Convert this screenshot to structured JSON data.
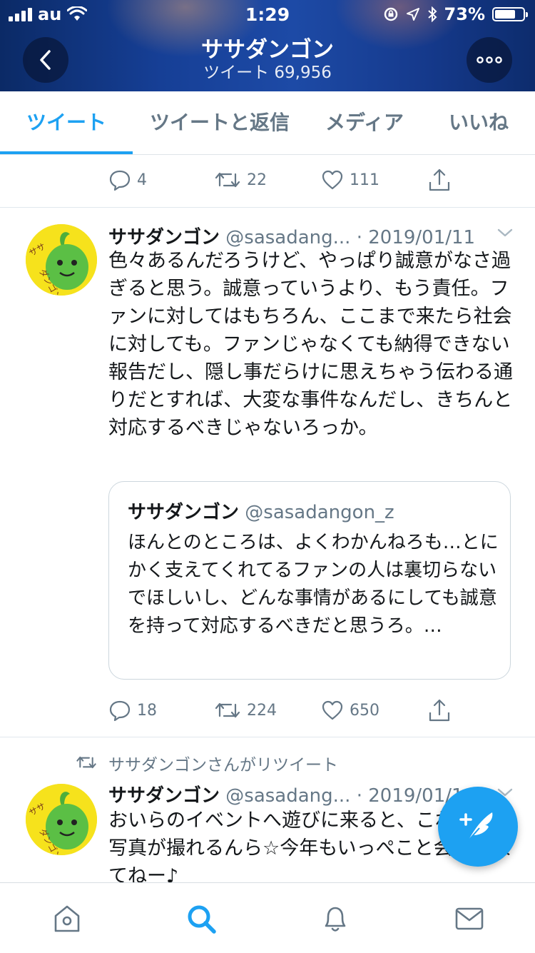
{
  "status_bar": {
    "carrier": "au",
    "time": "1:29",
    "battery": "73%",
    "battery_level": 0.73
  },
  "header": {
    "title": "ササダンゴン",
    "subtitle": "ツイート 69,956"
  },
  "tabs": [
    {
      "label": "ツイート",
      "active": true
    },
    {
      "label": "ツイートと返信",
      "active": false
    },
    {
      "label": "メディア",
      "active": false
    },
    {
      "label": "いいね",
      "active": false
    }
  ],
  "prev_tweet": {
    "replies": "4",
    "retweets": "22",
    "likes": "111"
  },
  "tweet1": {
    "name": "ササダンゴン",
    "handle": "@sasadang...",
    "date": "· 2019/01/11",
    "text": "色々あるんだろうけど、やっぱり誠意がなさ過ぎると思う。誠意っていうより、もう責任。ファンに対してはもちろん、ここまで来たら社会に対しても。ファンじゃなくても納得できない報告だし、隠し事だらけに思えちゃう伝わる通りだとすれば、大変な事件なんだし、きちんと対応するべきじゃないろっか。",
    "quote": {
      "name": "ササダンゴン",
      "handle": "@sasadangon_z",
      "text": "ほんとのところは、よくわかんねろも…とにかく支えてくれてるファンの人は裏切らないでほしいし、どんな事情があるにしても誠意を持って対応するべきだと思うろ。…"
    },
    "replies": "18",
    "retweets": "224",
    "likes": "650"
  },
  "tweet2": {
    "retweet_label": "ササダンゴンさんがリツイート",
    "name": "ササダンゴン",
    "handle": "@sasadang...",
    "date": "· 2019/01/1",
    "text": "おいらのイベントへ遊びに来ると、こわいげな写真が撮れるんら☆今年もいっぺこと会いに来てねー♪"
  },
  "icons": {
    "back": "chevron-left-icon",
    "more": "more-icon",
    "reply": "reply-icon",
    "retweet": "retweet-icon",
    "like": "heart-icon",
    "share": "share-icon",
    "compose": "compose-tweet-icon",
    "home": "home-icon",
    "search": "search-icon",
    "notifications": "bell-icon",
    "messages": "mail-icon"
  },
  "colors": {
    "accent": "#1da1f2",
    "muted": "#657786",
    "avatar_bg": "#f6e21c"
  }
}
